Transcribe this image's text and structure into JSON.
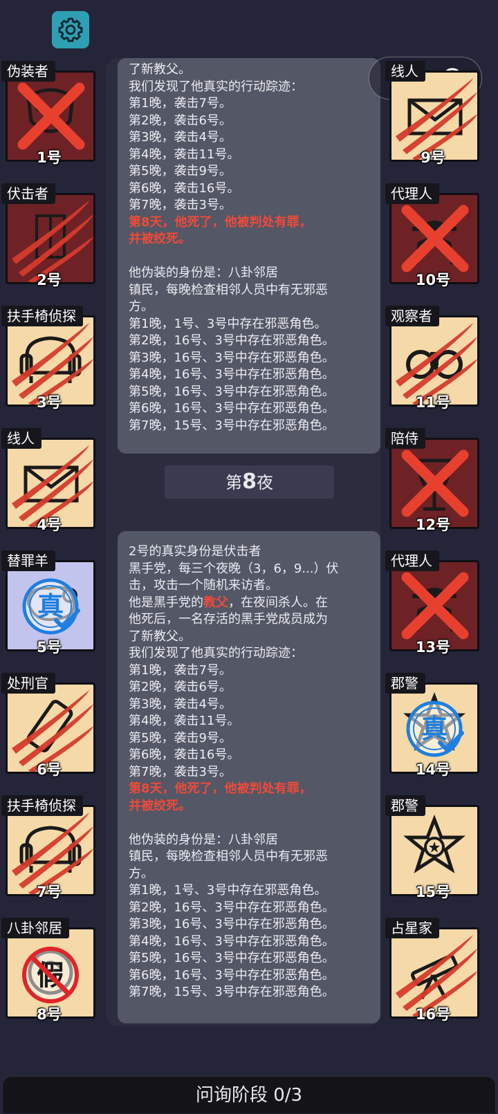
{
  "header": {
    "settings_icon": "gear-icon",
    "capsule": {
      "more_icon": "more-dots-icon",
      "close_icon": "target-circle-icon"
    }
  },
  "left_players": [
    {
      "role": "伪装者",
      "number": "1号",
      "state": "killed",
      "icon": "mask-icon"
    },
    {
      "role": "伏击者",
      "number": "2号",
      "state": "clawed-dead",
      "icon": "figure-icon"
    },
    {
      "role": "扶手椅侦探",
      "number": "3号",
      "state": "clawed",
      "icon": "armchair-icon"
    },
    {
      "role": "线人",
      "number": "4号",
      "state": "clawed",
      "icon": "envelope-icon"
    },
    {
      "role": "替罪羊",
      "number": "5号",
      "state": "true-stamp",
      "icon": "sheep-icon",
      "stamp": "真"
    },
    {
      "role": "处刑官",
      "number": "6号",
      "state": "clawed",
      "icon": "scroll-icon"
    },
    {
      "role": "扶手椅侦探",
      "number": "7号",
      "state": "clawed",
      "icon": "armchair-icon"
    },
    {
      "role": "八卦邻居",
      "number": "8号",
      "state": "fake-stamp",
      "icon": "gossip-icon",
      "stamp": "假"
    }
  ],
  "right_players": [
    {
      "role": "线人",
      "number": "9号",
      "state": "clawed",
      "icon": "envelope-icon"
    },
    {
      "role": "代理人",
      "number": "10号",
      "state": "killed",
      "icon": "agent-icon"
    },
    {
      "role": "观察者",
      "number": "11号",
      "state": "clawed",
      "icon": "binoculars-icon"
    },
    {
      "role": "陪侍",
      "number": "12号",
      "state": "killed",
      "icon": "wineglass-icon"
    },
    {
      "role": "代理人",
      "number": "13号",
      "state": "killed",
      "icon": "agent-icon"
    },
    {
      "role": "郡警",
      "number": "14号",
      "state": "true-stamp",
      "icon": "sheriff-badge-icon",
      "stamp": "真"
    },
    {
      "role": "郡警",
      "number": "15号",
      "state": "normal",
      "icon": "sheriff-badge-icon"
    },
    {
      "role": "占星家",
      "number": "16号",
      "state": "clawed",
      "icon": "telescope-icon"
    }
  ],
  "log": {
    "bubble1": [
      {
        "text": "了新教父。"
      },
      {
        "text": "我们发现了他真实的行动踪迹："
      },
      {
        "text": "第1晚，袭击7号。"
      },
      {
        "text": "第2晚，袭击6号。"
      },
      {
        "text": "第3晚，袭击4号。"
      },
      {
        "text": "第4晚，袭击11号。"
      },
      {
        "text": "第5晚，袭击9号。"
      },
      {
        "text": "第6晚，袭击16号。"
      },
      {
        "text": "第7晚，袭击3号。"
      },
      {
        "text": "第8天，他死了，他被判处有罪，",
        "red": true
      },
      {
        "text": "并被绞死。",
        "red": true
      },
      {
        "text": ""
      },
      {
        "text": "他伪装的身份是：八卦邻居"
      },
      {
        "text": "镇民，每晚检查相邻人员中有无邪恶"
      },
      {
        "text": "方。"
      },
      {
        "text": "第1晚，1号、3号中存在邪恶角色。"
      },
      {
        "text": "第2晚，16号、3号中存在邪恶角色。"
      },
      {
        "text": "第3晚，16号、3号中存在邪恶角色。"
      },
      {
        "text": "第4晚，16号、3号中存在邪恶角色。"
      },
      {
        "text": "第5晚，16号、3号中存在邪恶角色。"
      },
      {
        "text": "第6晚，16号、3号中存在邪恶角色。"
      },
      {
        "text": "第7晚，15号、3号中存在邪恶角色。"
      }
    ],
    "night_label": {
      "prefix": "第",
      "number": "8",
      "suffix": "夜"
    },
    "bubble2": [
      {
        "text": "2号的真实身份是伏击者"
      },
      {
        "text": "黑手党，每三个夜晚（3，6，9...）伏"
      },
      {
        "text": "击，攻击一个随机来访者。"
      },
      {
        "pre": "他是黑手党的",
        "hl": "教父",
        "post": "，在夜间杀人。在"
      },
      {
        "text": "他死后，一名存活的黑手党成员成为"
      },
      {
        "text": "了新教父。"
      },
      {
        "text": "我们发现了他真实的行动踪迹："
      },
      {
        "text": "第1晚，袭击7号。"
      },
      {
        "text": "第2晚，袭击6号。"
      },
      {
        "text": "第3晚，袭击4号。"
      },
      {
        "text": "第4晚，袭击11号。"
      },
      {
        "text": "第5晚，袭击9号。"
      },
      {
        "text": "第6晚，袭击16号。"
      },
      {
        "text": "第7晚，袭击3号。"
      },
      {
        "text": "第8天，他死了，他被判处有罪，",
        "red": true
      },
      {
        "text": "并被绞死。",
        "red": true
      },
      {
        "text": ""
      },
      {
        "text": "他伪装的身份是：八卦邻居"
      },
      {
        "text": "镇民，每晚检查相邻人员中有无邪恶"
      },
      {
        "text": "方。"
      },
      {
        "text": "第1晚，1号、3号中存在邪恶角色。"
      },
      {
        "text": "第2晚，16号、3号中存在邪恶角色。"
      },
      {
        "text": "第3晚，16号、3号中存在邪恶角色。"
      },
      {
        "text": "第4晚，16号、3号中存在邪恶角色。"
      },
      {
        "text": "第5晚，16号、3号中存在邪恶角色。"
      },
      {
        "text": "第6晚，16号、3号中存在邪恶角色。"
      },
      {
        "text": "第7晚，15号、3号中存在邪恶角色。"
      }
    ]
  },
  "bottom_bar": {
    "label": "问询阶段 0/3"
  },
  "colors": {
    "background": "#25253a",
    "bubble": "#535766",
    "red_text": "#f04a3a",
    "claw": "#d63b2c",
    "cross": "#e8402f",
    "dead_tile": "#6e2226",
    "cream_tile": "#f5d9a8",
    "stamp_blue": "#1e7fe0"
  }
}
